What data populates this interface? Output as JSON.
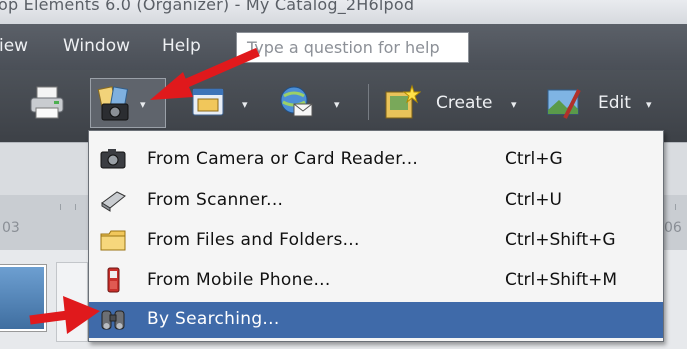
{
  "title_bar": {
    "text": "op Elements 6.0 (Organizer) - My Catalog_2H6lpod"
  },
  "menubar": {
    "items": [
      {
        "label": "iew"
      },
      {
        "label": "Window"
      },
      {
        "label": "Help"
      }
    ],
    "help_search": {
      "placeholder": "Type a question for help"
    }
  },
  "toolbar": {
    "create_label": "Create",
    "edit_label": "Edit",
    "dropdown_glyph": "▾"
  },
  "timeline": {
    "left_label": "03",
    "right_label": "06"
  },
  "import_menu": {
    "items": [
      {
        "label": "From Camera or Card Reader...",
        "shortcut": "Ctrl+G",
        "icon": "camera-icon"
      },
      {
        "label": "From Scanner...",
        "shortcut": "Ctrl+U",
        "icon": "scanner-icon"
      },
      {
        "label": "From Files and Folders...",
        "shortcut": "Ctrl+Shift+G",
        "icon": "folder-icon"
      },
      {
        "label": "From Mobile Phone...",
        "shortcut": "Ctrl+Shift+M",
        "icon": "mobile-phone-icon"
      },
      {
        "label": "By Searching...",
        "shortcut": "",
        "icon": "binoculars-icon",
        "selected": true
      }
    ]
  },
  "colors": {
    "menu_highlight": "#3f6aa9",
    "annotation_arrow": "#e0191c",
    "toolbar_bg": "#44484f"
  }
}
